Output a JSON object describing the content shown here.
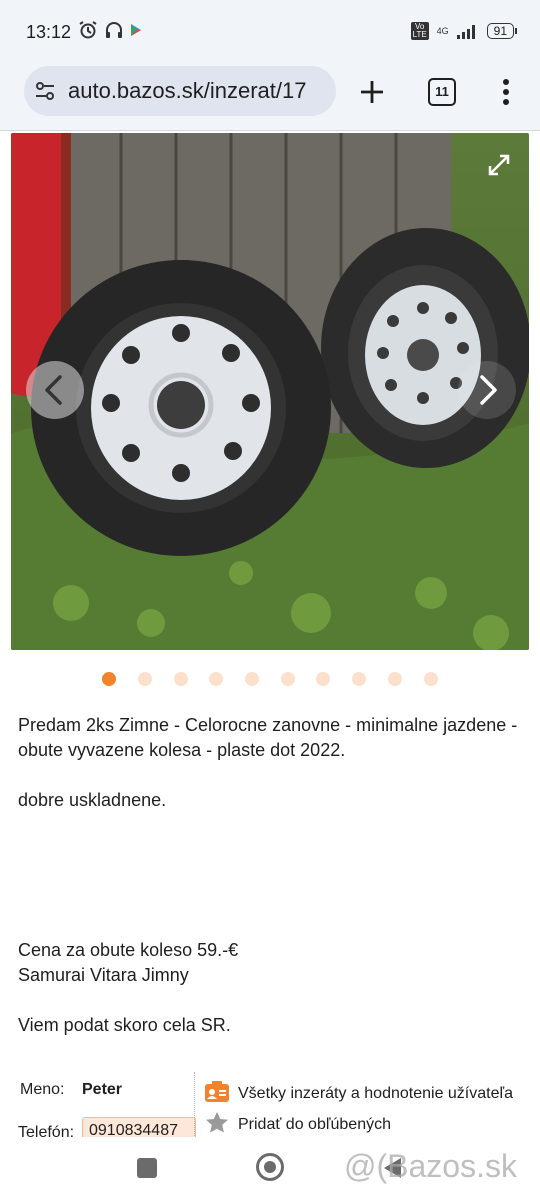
{
  "status_bar": {
    "time": "13:12",
    "network": "4G",
    "volte": "Vo LTE",
    "battery": "91"
  },
  "browser": {
    "url": "auto.bazos.sk/inzerat/17",
    "tab_count": "11"
  },
  "gallery": {
    "dot_count": 10,
    "active_dot": 0
  },
  "listing": {
    "description_1": "Predam 2ks Zimne - Celorocne zanovne - minimalne jazdene - obute vyvazene kolesa - plaste dot 2022.",
    "description_2": "dobre uskladnene.",
    "price_line": "Cena za obute koleso 59.-€",
    "models_line": "Samurai Vitara Jimny",
    "delivery_line": "Viem podat skoro cela SR."
  },
  "seller": {
    "name_label": "Meno:",
    "name_value": "Peter",
    "phone_label": "Telefón:",
    "phone_value": "0910834487",
    "all_ads_link": "Všetky inzeráty a hodnotenie užívateľa",
    "favorite_link": "Pridať do obľúbených"
  },
  "watermark": "@(Bazos.sk",
  "colors": {
    "accent": "#f0832b",
    "dot_inactive": "#fde0cc",
    "phone_bg": "#fde7d8"
  }
}
